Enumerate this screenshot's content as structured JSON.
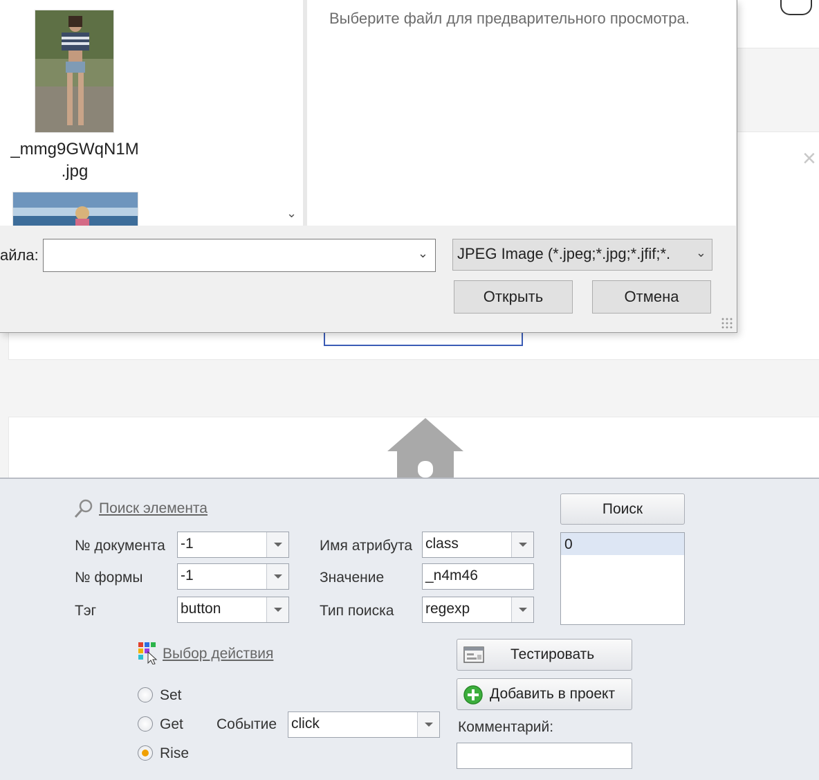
{
  "dialog": {
    "file_list": {
      "files": [
        {
          "name_line1": "_mmg9GWqN1M",
          "name_line2": ".jpg"
        }
      ]
    },
    "preview_message": "Выберите файл для предварительного просмотра.",
    "filename_label": "айла:",
    "filename_value": "",
    "filetype_value": "JPEG Image (*.jpeg;*.jpg;*.jfif;*.",
    "open_label": "Открыть",
    "cancel_label": "Отмена"
  },
  "panel": {
    "search_link": "Поиск элемента",
    "search_button": "Поиск",
    "doc_number": {
      "label": "№ документа",
      "value": "-1"
    },
    "form_number": {
      "label": "№ формы",
      "value": "-1"
    },
    "tag": {
      "label": "Тэг",
      "value": "button"
    },
    "attr_name": {
      "label": "Имя атрибута",
      "value": "class"
    },
    "attr_value": {
      "label": "Значение",
      "value": "_n4m46"
    },
    "search_type": {
      "label": "Тип поиска",
      "value": "regexp"
    },
    "results": [
      "0"
    ],
    "action_link": "Выбор действия",
    "test_button": "Тестировать",
    "add_button": "Добавить в проект",
    "comment_label": "Комментарий:",
    "comment_value": "",
    "modes": {
      "set": "Set",
      "get": "Get",
      "rise": "Rise",
      "selected": "Rise"
    },
    "event": {
      "label": "Событие",
      "value": "click"
    }
  },
  "colors": {
    "panel_bg": "#e9ecf1",
    "dialog_bg": "#f0f0f0",
    "radio_selected": "#f0a000",
    "add_icon": "#3cae3c"
  }
}
